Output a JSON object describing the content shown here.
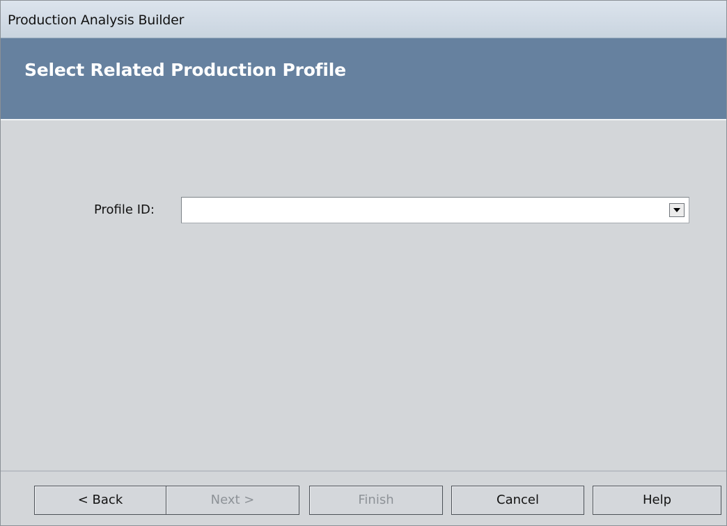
{
  "window": {
    "title": "Production Analysis Builder"
  },
  "header": {
    "title": "Select Related Production Profile"
  },
  "form": {
    "profile_label": "Profile ID:",
    "profile_value": ""
  },
  "buttons": {
    "back": "< Back",
    "next": "Next >",
    "finish": "Finish",
    "cancel": "Cancel",
    "help": "Help"
  }
}
